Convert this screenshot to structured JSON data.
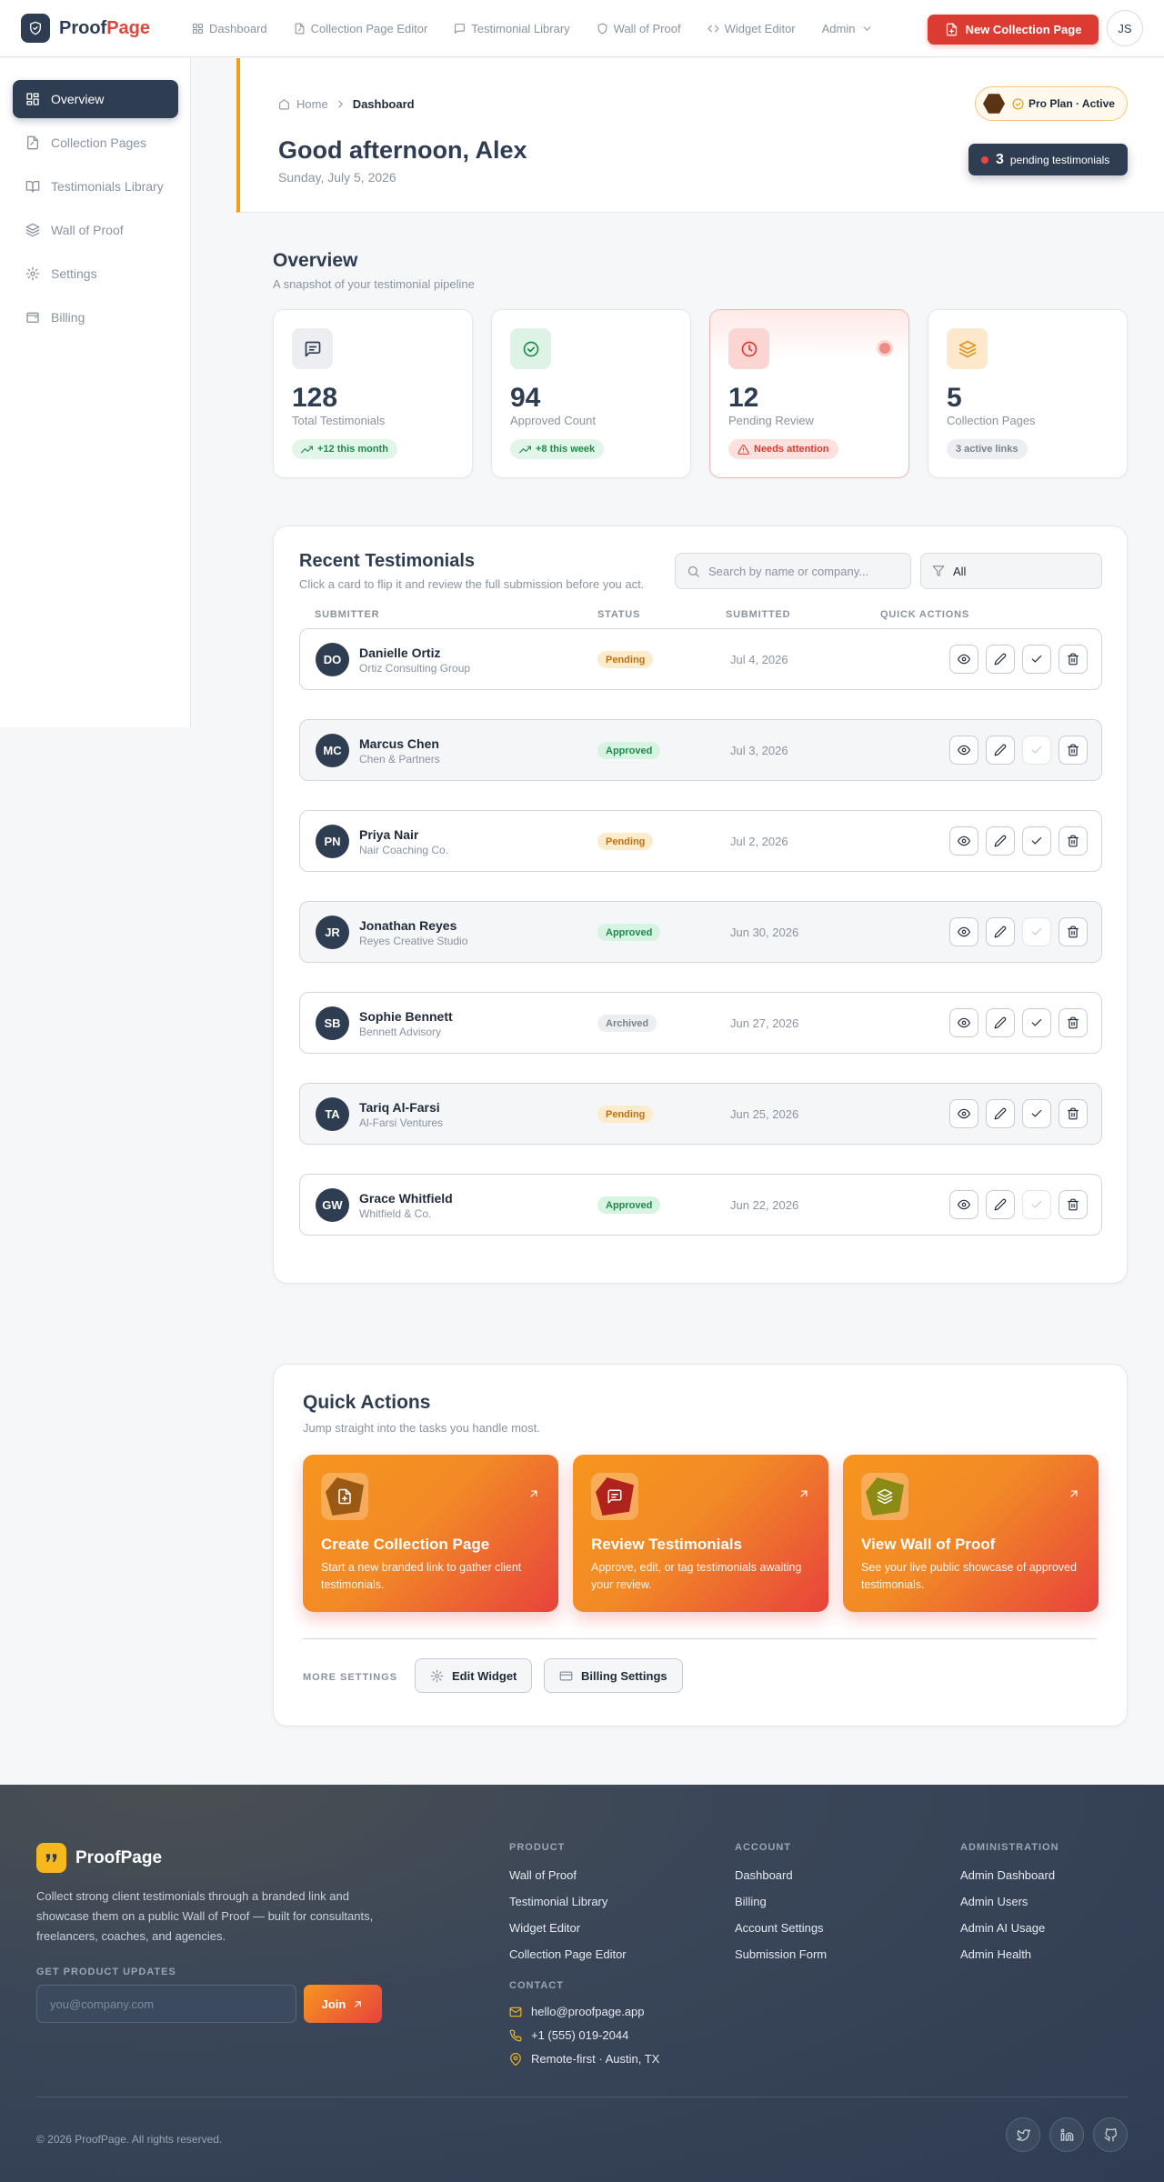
{
  "brand": {
    "name_part1": "Proof",
    "name_part2": "Page"
  },
  "topnav": {
    "links": [
      "Dashboard",
      "Collection Page Editor",
      "Testimonial Library",
      "Wall of Proof",
      "Widget Editor",
      "Admin"
    ],
    "new_button": "New Collection Page",
    "user_initials": "JS"
  },
  "sidebar": {
    "items": [
      "Overview",
      "Collection Pages",
      "Testimonials Library",
      "Wall of Proof",
      "Settings",
      "Billing"
    ],
    "active": "Overview"
  },
  "header": {
    "breadcrumb": {
      "home": "Home",
      "current": "Dashboard"
    },
    "greeting": "Good afternoon, Alex",
    "date": "Sunday, July 5, 2026",
    "plan": "Pro Plan · Active",
    "pending_count": "3",
    "pending_label": "pending testimonials"
  },
  "overview": {
    "title": "Overview",
    "subtitle": "A snapshot of your testimonial pipeline",
    "stats": [
      {
        "value": "128",
        "label": "Total Testimonials",
        "badge": "+12 this month",
        "icon": "message-square-icon",
        "tone": "neutral"
      },
      {
        "value": "94",
        "label": "Approved Count",
        "badge": "+8 this week",
        "icon": "check-circle-icon",
        "tone": "green"
      },
      {
        "value": "12",
        "label": "Pending Review",
        "badge": "Needs attention",
        "icon": "clock-icon",
        "tone": "red"
      },
      {
        "value": "5",
        "label": "Collection Pages",
        "badge": "3 active links",
        "icon": "layers-icon",
        "tone": "orange"
      }
    ]
  },
  "recent": {
    "title": "Recent Testimonials",
    "subtitle": "Click a card to flip it and review the full submission before you act.",
    "search_placeholder": "Search by name or company...",
    "filter_value": "All",
    "columns": [
      "SUBMITTER",
      "STATUS",
      "SUBMITTED",
      "QUICK ACTIONS"
    ],
    "rows": [
      {
        "initials": "DO",
        "name": "Danielle Ortiz",
        "company": "Ortiz Consulting Group",
        "status": "Pending",
        "date": "Jul 4, 2026"
      },
      {
        "initials": "MC",
        "name": "Marcus Chen",
        "company": "Chen & Partners",
        "status": "Approved",
        "date": "Jul 3, 2026"
      },
      {
        "initials": "PN",
        "name": "Priya Nair",
        "company": "Nair Coaching Co.",
        "status": "Pending",
        "date": "Jul 2, 2026"
      },
      {
        "initials": "JR",
        "name": "Jonathan Reyes",
        "company": "Reyes Creative Studio",
        "status": "Approved",
        "date": "Jun 30, 2026"
      },
      {
        "initials": "SB",
        "name": "Sophie Bennett",
        "company": "Bennett Advisory",
        "status": "Archived",
        "date": "Jun 27, 2026"
      },
      {
        "initials": "TA",
        "name": "Tariq Al-Farsi",
        "company": "Al-Farsi Ventures",
        "status": "Pending",
        "date": "Jun 25, 2026"
      },
      {
        "initials": "GW",
        "name": "Grace Whitfield",
        "company": "Whitfield & Co.",
        "status": "Approved",
        "date": "Jun 22, 2026"
      }
    ]
  },
  "quick_actions": {
    "title": "Quick Actions",
    "subtitle": "Jump straight into the tasks you handle most.",
    "tiles": [
      {
        "title": "Create Collection Page",
        "desc": "Start a new branded link to gather client testimonials.",
        "icon": "file-plus-icon",
        "color": "#9a5a14"
      },
      {
        "title": "Review Testimonials",
        "desc": "Approve, edit, or tag testimonials awaiting your review.",
        "icon": "message-square-icon",
        "color": "#b0231c"
      },
      {
        "title": "View Wall of Proof",
        "desc": "See your live public showcase of approved testimonials.",
        "icon": "layers-icon",
        "color": "#8a8a14"
      }
    ],
    "more_label": "MORE SETTINGS",
    "edit_widget": "Edit Widget",
    "billing_settings": "Billing Settings"
  },
  "footer": {
    "brand": "ProofPage",
    "description": "Collect strong client testimonials through a branded link and showcase them on a public Wall of Proof — built for consultants, freelancers, coaches, and agencies.",
    "updates_label": "GET PRODUCT UPDATES",
    "email_placeholder": "you@company.com",
    "join": "Join",
    "product": {
      "heading": "PRODUCT",
      "links": [
        "Wall of Proof",
        "Testimonial Library",
        "Widget Editor",
        "Collection Page Editor"
      ]
    },
    "account": {
      "heading": "ACCOUNT",
      "links": [
        "Dashboard",
        "Billing",
        "Account Settings",
        "Submission Form"
      ]
    },
    "administration": {
      "heading": "ADMINISTRATION",
      "links": [
        "Admin Dashboard",
        "Admin Users",
        "Admin AI Usage",
        "Admin Health"
      ]
    },
    "contact": {
      "heading": "CONTACT",
      "email": "hello@proofpage.app",
      "phone": "+1 (555) 019-2044",
      "location": "Remote-first · Austin, TX"
    },
    "copyright": "© 2026 ProofPage. All rights reserved."
  },
  "colors": {
    "primary": "#2e3d52",
    "accent_red": "#dc3b32",
    "accent_orange": "#f59e1b",
    "footer_bg": "#2f3c52"
  }
}
